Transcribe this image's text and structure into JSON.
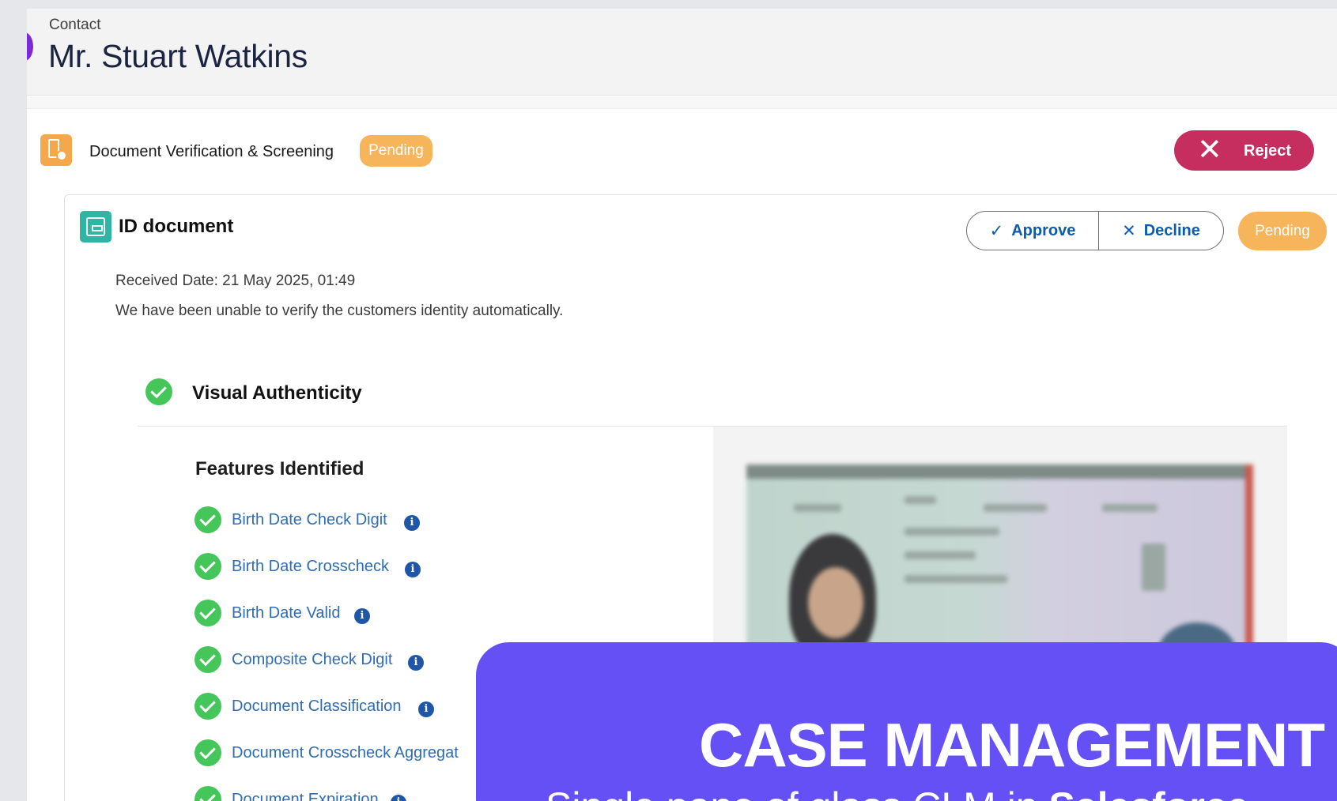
{
  "record": {
    "object_label": "Contact",
    "name": "Mr. Stuart Watkins"
  },
  "section": {
    "icon": "hourglass-clock-icon",
    "title": "Document Verification & Screening",
    "status": "Pending",
    "reject_label": "Reject"
  },
  "document": {
    "icon": "id-card-icon",
    "title": "ID document",
    "approve_label": "Approve",
    "decline_label": "Decline",
    "status": "Pending",
    "received": "Received Date:  21 May 2025, 01:49",
    "message": "We have been unable to verify the customers identity automatically."
  },
  "visual_authenticity": {
    "title": "Visual Authenticity",
    "features_title": "Features Identified",
    "features": [
      "Birth Date Check Digit",
      "Birth Date Crosscheck",
      "Birth Date Valid",
      "Composite Check Digit",
      "Document Classification",
      "Document Crosscheck Aggregat",
      "Document Expiration"
    ]
  },
  "banner": {
    "title": "CASE MANAGEMENT",
    "subtitle_prefix": "Single pane of glass CLM in ",
    "subtitle_bold": "Salesforce"
  },
  "colors": {
    "pending": "#f6b45b",
    "reject": "#c62e5f",
    "success": "#45c65a",
    "link": "#2f6cb3",
    "banner": "#6550f6"
  }
}
